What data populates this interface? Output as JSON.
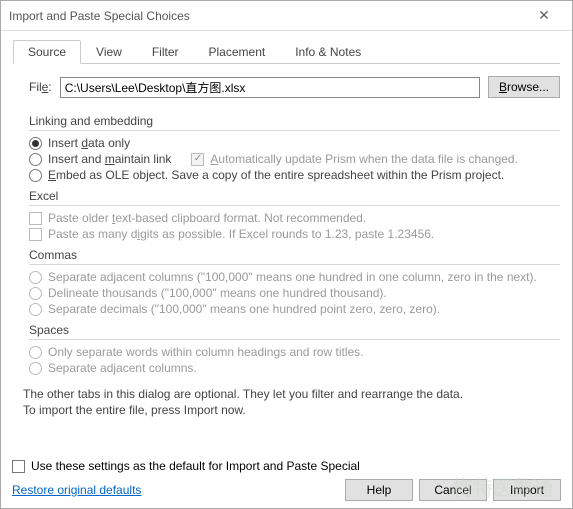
{
  "window": {
    "title": "Import and Paste Special Choices",
    "close": "✕"
  },
  "tabs": {
    "source": "Source",
    "view": "View",
    "filter": "Filter",
    "placement": "Placement",
    "info": "Info & Notes"
  },
  "file": {
    "label": "File:",
    "value": "C:\\Users\\Lee\\Desktop\\直方图.xlsx",
    "browse": "Browse..."
  },
  "linking": {
    "title": "Linking and embedding",
    "insert_data": "Insert data only",
    "maintain_link": "Insert and maintain link",
    "auto_update": "Automatically update Prism when the data file is changed.",
    "ole": "Embed as OLE object. Save a copy of the entire spreadsheet within the Prism project."
  },
  "excel": {
    "title": "Excel",
    "older": "Paste older text-based clipboard format. Not recommended.",
    "digits": "Paste as many digits as possible. If Excel rounds to 1.23, paste 1.23456."
  },
  "commas": {
    "title": "Commas",
    "adjacent": "Separate adjacent columns (\"100,000\" means one hundred in one column, zero in the next).",
    "thousands": "Delineate thousands (\"100,000\" means one hundred thousand).",
    "decimals": "Separate decimals (\"100,000\" means one hundred point zero, zero, zero)."
  },
  "spaces": {
    "title": "Spaces",
    "words": "Only separate words within column headings and row titles.",
    "columns": "Separate adjacent columns."
  },
  "note1": "The other tabs in this dialog are optional. They let you filter and rearrange the data.",
  "note2": "To import the entire file, press Import now.",
  "footer": {
    "default_check": "Use these settings as the default for Import and Paste Special",
    "restore": "Restore original defaults",
    "help": "Help",
    "cancel": "Cancel",
    "import": "Import"
  },
  "watermark": "梅特医数通"
}
